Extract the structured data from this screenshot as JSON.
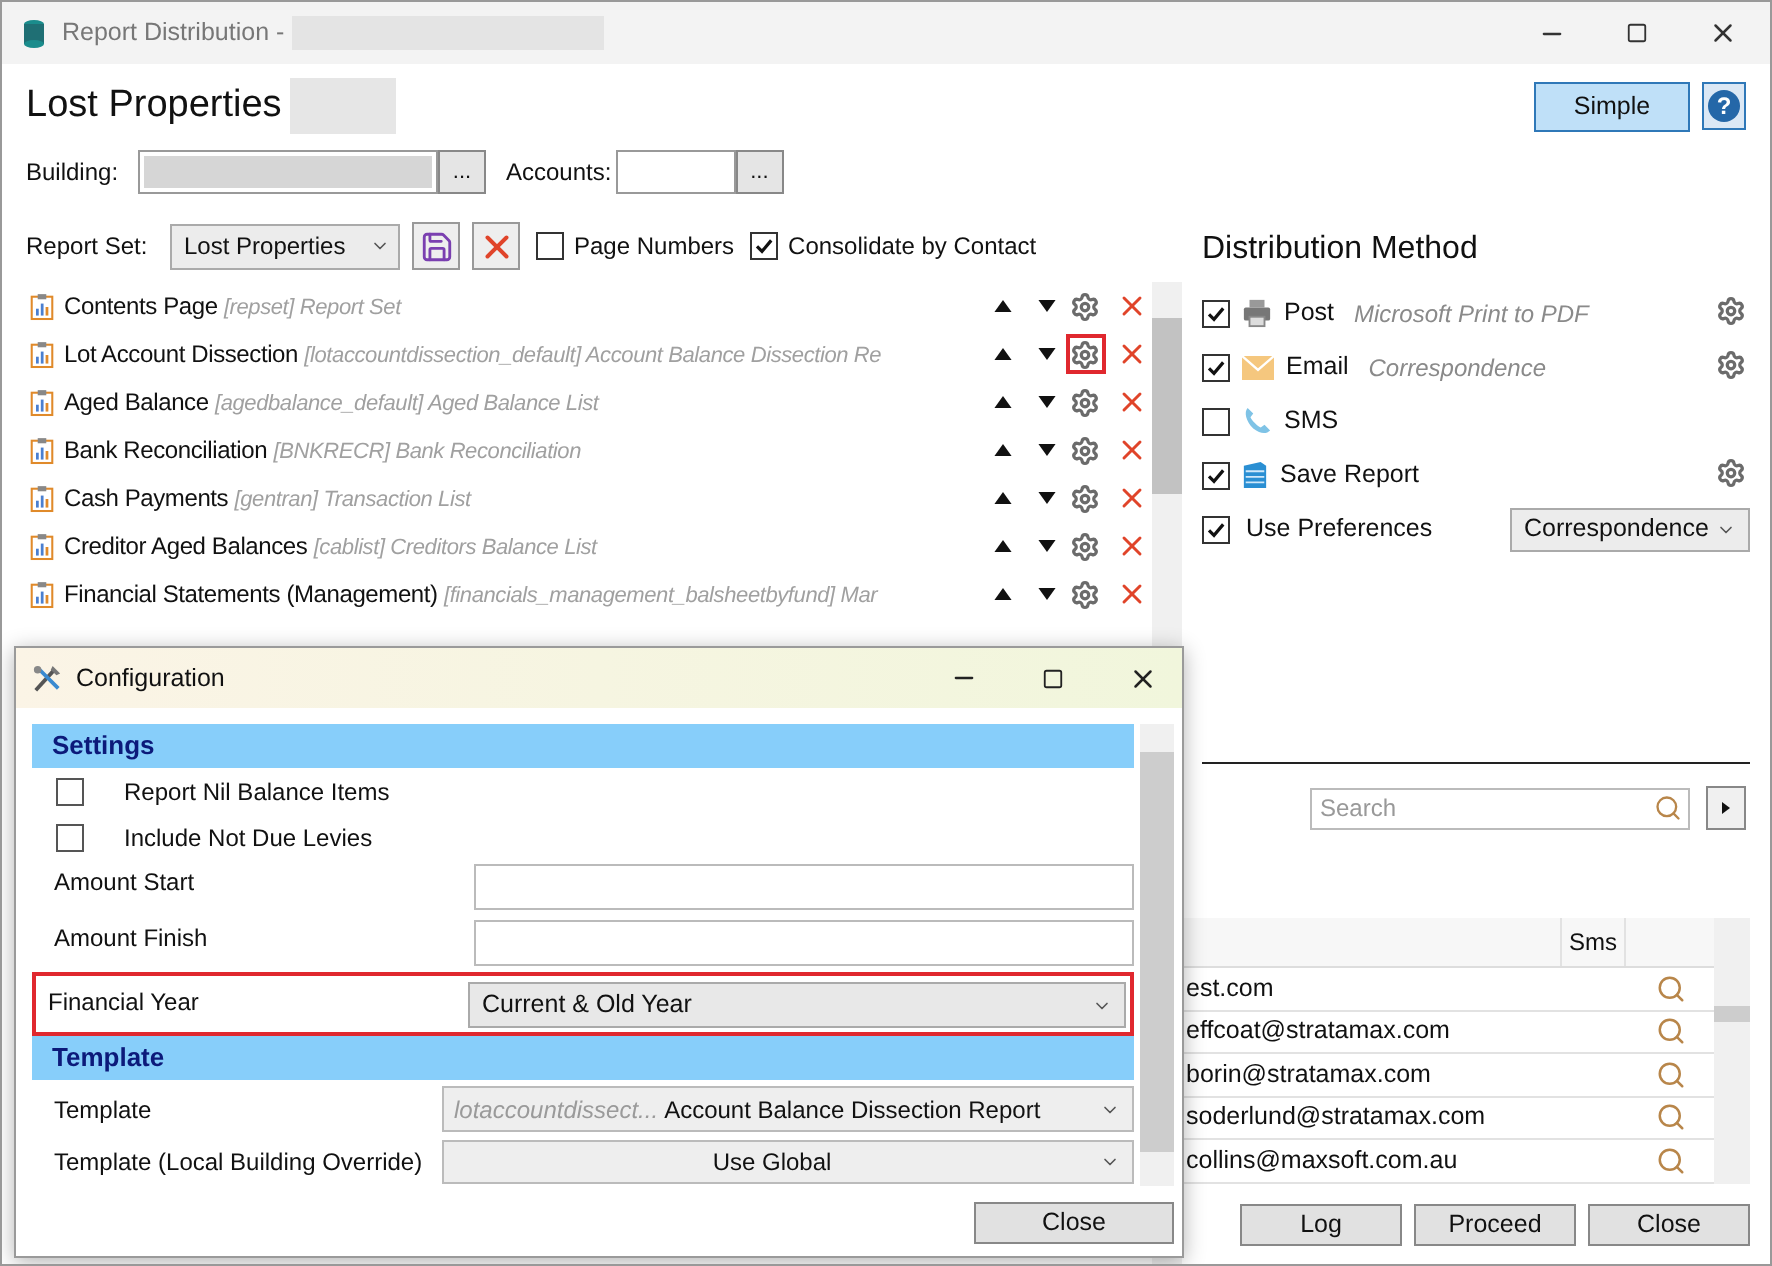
{
  "window": {
    "title": "Report Distribution -"
  },
  "header": {
    "title": "Lost Properties",
    "buttons": [
      {
        "kind": "primary",
        "label": "Simple"
      },
      {
        "kind": "help",
        "label": "?"
      }
    ]
  },
  "building": {
    "label": "Building:",
    "button": "..."
  },
  "accounts": {
    "label": "Accounts:",
    "button": "..."
  },
  "report_set": {
    "label": "Report Set:",
    "value": "Lost Properties"
  },
  "options": [
    {
      "label": "Page Numbers",
      "checked": false
    },
    {
      "label": "Consolidate by Contact",
      "checked": true
    }
  ],
  "reports": [
    {
      "name": "Contents Page",
      "detail": "[repset] Report Set",
      "highlighted": false
    },
    {
      "name": "Lot Account Dissection",
      "detail": "[lotaccountdissection_default] Account Balance Dissection Re",
      "highlighted": true
    },
    {
      "name": "Aged Balance",
      "detail": "[agedbalance_default] Aged Balance List",
      "highlighted": false
    },
    {
      "name": "Bank Reconciliation",
      "detail": "[BNKRECR] Bank Reconciliation",
      "highlighted": false
    },
    {
      "name": "Cash Payments",
      "detail": "[gentran] Transaction List",
      "highlighted": false
    },
    {
      "name": "Creditor Aged Balances",
      "detail": "[cablist] Creditors Balance List",
      "highlighted": false
    },
    {
      "name": "Financial Statements (Management)",
      "detail": "[financials_management_balsheetbyfund] Mar",
      "highlighted": false
    }
  ],
  "distribution": {
    "title": "Distribution Method",
    "methods": [
      {
        "kind": "post",
        "label": "Post",
        "detail": "Microsoft Print to PDF",
        "checked": true,
        "settings": true
      },
      {
        "kind": "email",
        "label": "Email",
        "detail": "Correspondence",
        "checked": true,
        "settings": true
      },
      {
        "kind": "sms",
        "label": "SMS",
        "checked": false,
        "settings": false
      },
      {
        "kind": "save",
        "label": "Save Report",
        "checked": true,
        "settings": true
      }
    ],
    "preferences": {
      "label": "Use Preferences",
      "checked": true,
      "value": "Correspondence"
    }
  },
  "contacts": {
    "search": {
      "placeholder": "Search"
    },
    "columns": [
      "Sms"
    ],
    "rows": [
      {
        "email": "est.com"
      },
      {
        "email": "effcoat@stratamax.com"
      },
      {
        "email": "borin@stratamax.com"
      },
      {
        "email": "soderlund@stratamax.com"
      },
      {
        "email": "collins@maxsoft.com.au"
      }
    ]
  },
  "footer": {
    "buttons": [
      "Log",
      "Proceed",
      "Close"
    ]
  },
  "dialog": {
    "title": "Configuration",
    "sections": [
      {
        "title": "Settings",
        "items": [
          {
            "kind": "checkbox",
            "label": "Report Nil Balance Items",
            "checked": false
          },
          {
            "kind": "checkbox",
            "label": "Include Not Due Levies",
            "checked": false
          },
          {
            "kind": "text",
            "label": "Amount Start"
          },
          {
            "kind": "text",
            "label": "Amount Finish"
          },
          {
            "kind": "select",
            "label": "Financial Year",
            "value": "Current & Old Year",
            "highlighted": true
          }
        ]
      },
      {
        "title": "Template",
        "items": [
          {
            "kind": "template",
            "label": "Template",
            "prefix": "lotaccountdissect...",
            "value": "Account Balance Dissection Report"
          },
          {
            "kind": "centered",
            "label": "Template (Local Building Override)",
            "value": "Use Global"
          }
        ]
      }
    ],
    "button": "Close"
  }
}
